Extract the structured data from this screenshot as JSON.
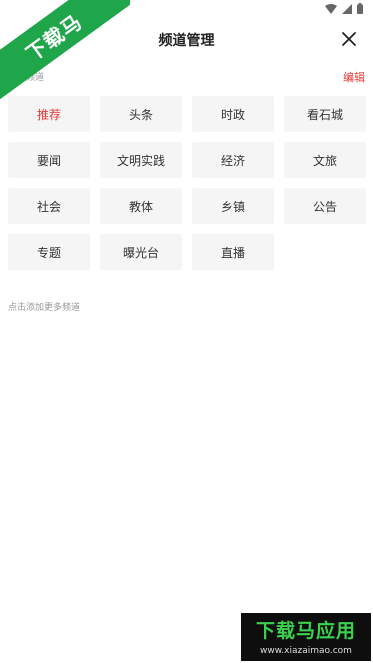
{
  "header": {
    "title": "频道管理",
    "close_icon": "close-icon"
  },
  "section": {
    "label": "我的频道",
    "edit_label": "编辑"
  },
  "channels": [
    {
      "label": "推荐"
    },
    {
      "label": "头条"
    },
    {
      "label": "时政"
    },
    {
      "label": "看石城"
    },
    {
      "label": "要闻"
    },
    {
      "label": "文明实践"
    },
    {
      "label": "经济"
    },
    {
      "label": "文旅"
    },
    {
      "label": "社会"
    },
    {
      "label": "教体"
    },
    {
      "label": "乡镇"
    },
    {
      "label": "公告"
    },
    {
      "label": "专题"
    },
    {
      "label": "曝光台"
    },
    {
      "label": "直播"
    }
  ],
  "active_channel": "推荐",
  "more_hint": "点击添加更多频道",
  "watermark": {
    "corner_text": "下载马",
    "logo_text": "下载马应用",
    "logo_url_text": "www.xiazaimao.com"
  },
  "colors": {
    "accent": "#e53935",
    "chip_bg": "#f5f5f5",
    "watermark_green": "#1fa64a"
  }
}
